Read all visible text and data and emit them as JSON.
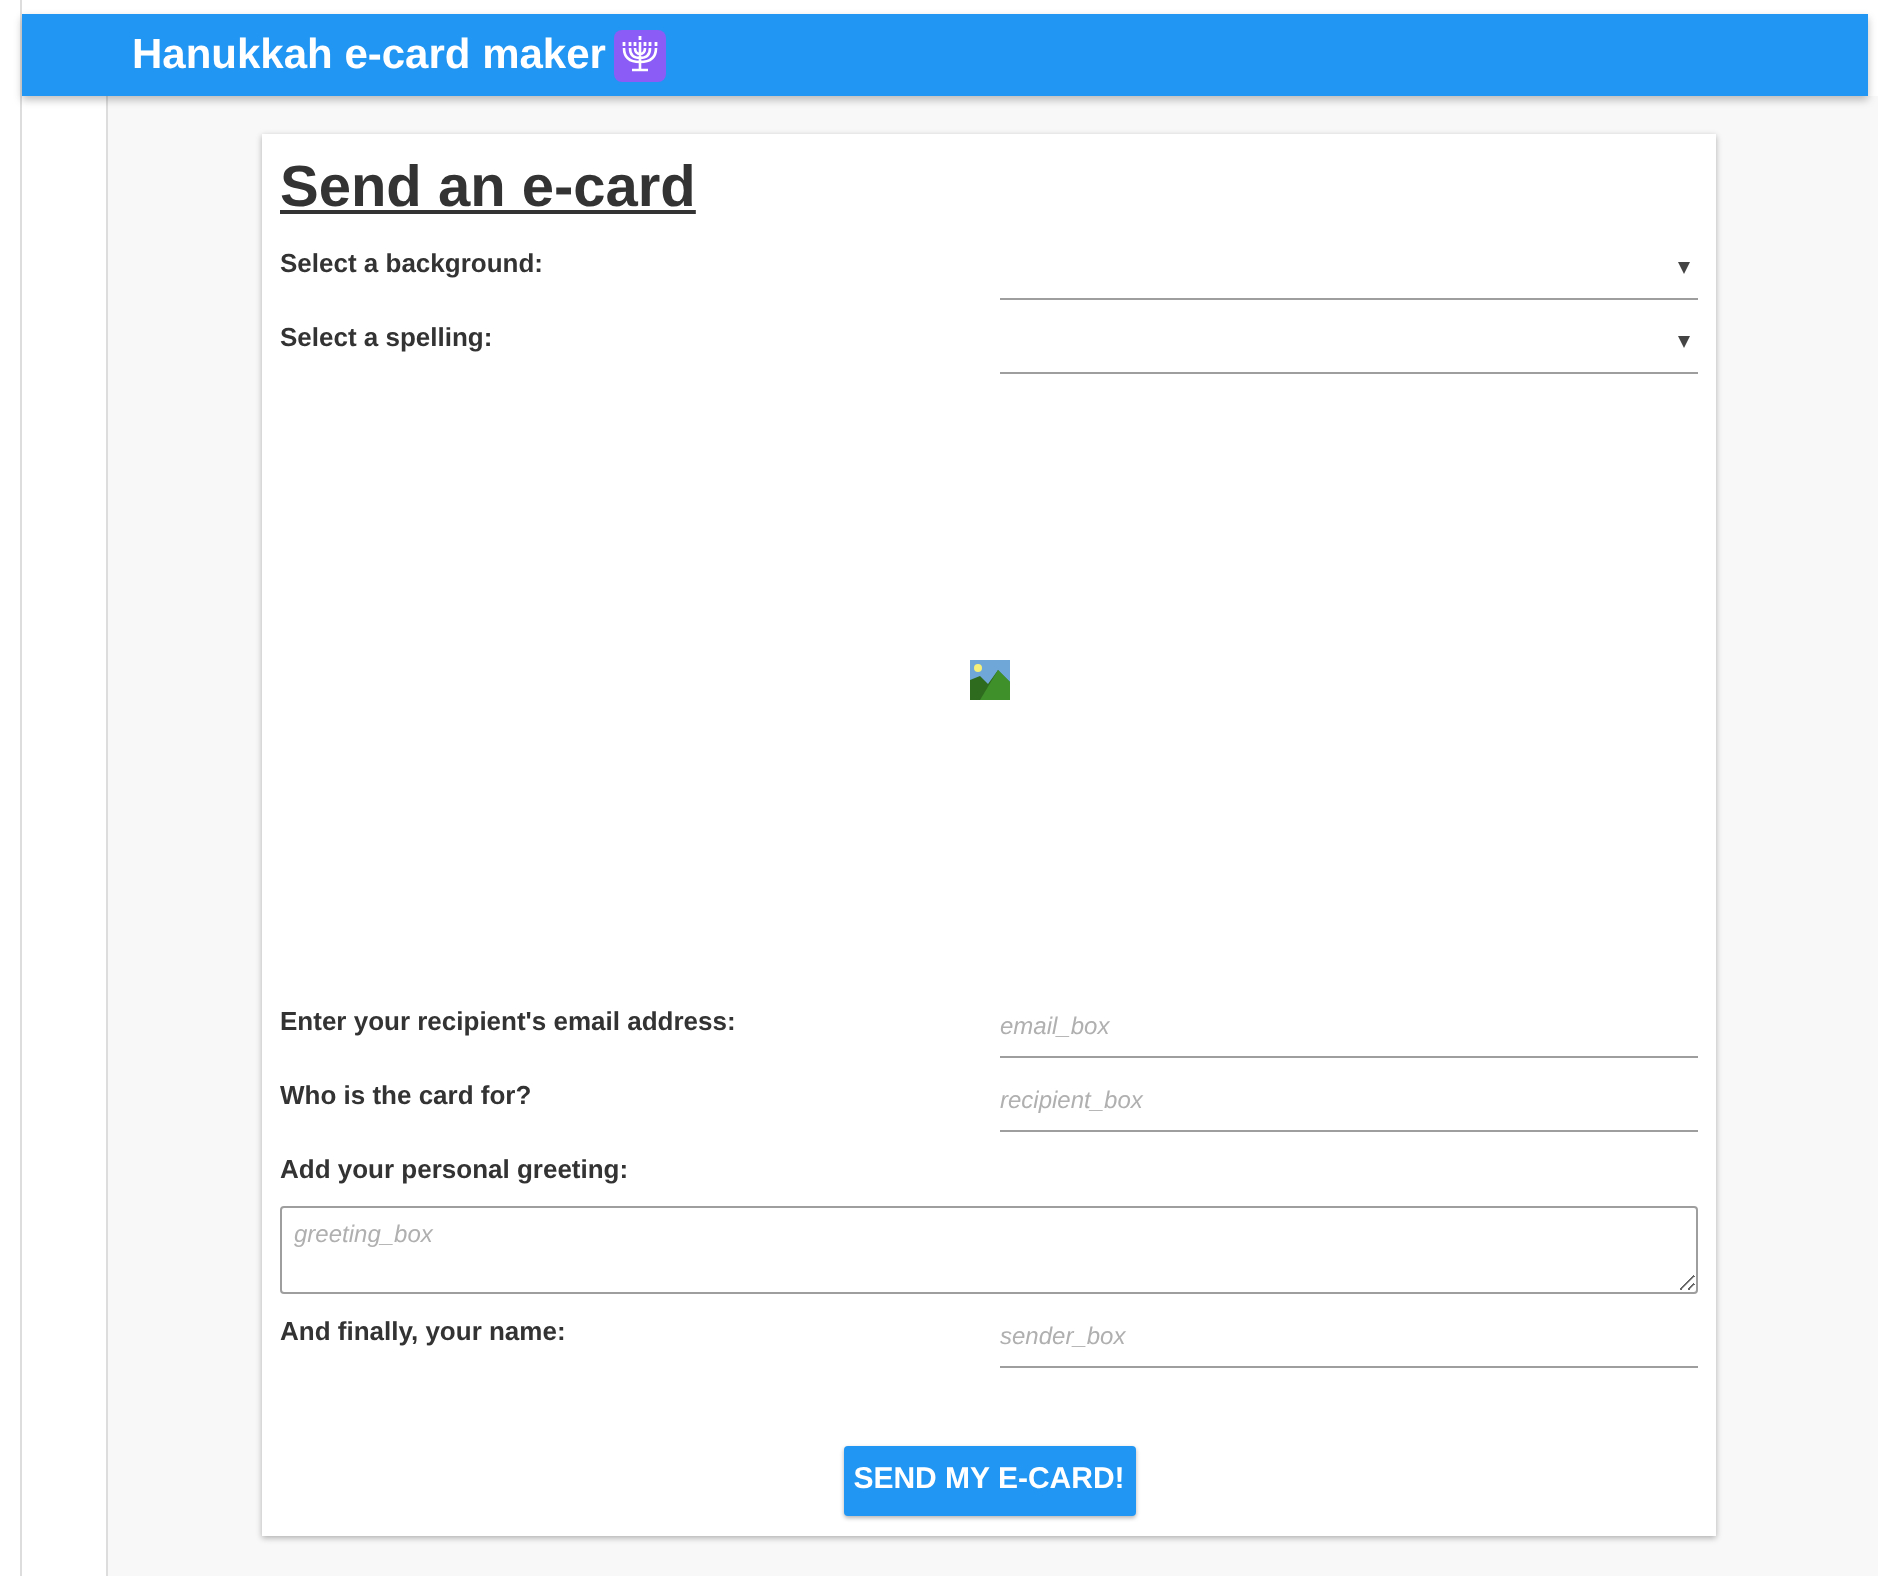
{
  "header": {
    "title": "Hanukkah e-card maker"
  },
  "card": {
    "heading": "Send an e-card",
    "fields": [
      {
        "kind": "select",
        "label": "Select a background:"
      },
      {
        "kind": "select",
        "label": "Select a spelling:"
      },
      {
        "kind": "image"
      },
      {
        "kind": "input",
        "label": "Enter your recipient's email address:",
        "placeholder": "email_box"
      },
      {
        "kind": "input",
        "label": "Who is the card for?",
        "placeholder": "recipient_box"
      },
      {
        "kind": "textarea",
        "label": "Add your personal greeting:",
        "placeholder": "greeting_box"
      },
      {
        "kind": "input",
        "label": "And finally, your name:",
        "placeholder": "sender_box"
      }
    ],
    "button": "SEND MY E-CARD!"
  }
}
